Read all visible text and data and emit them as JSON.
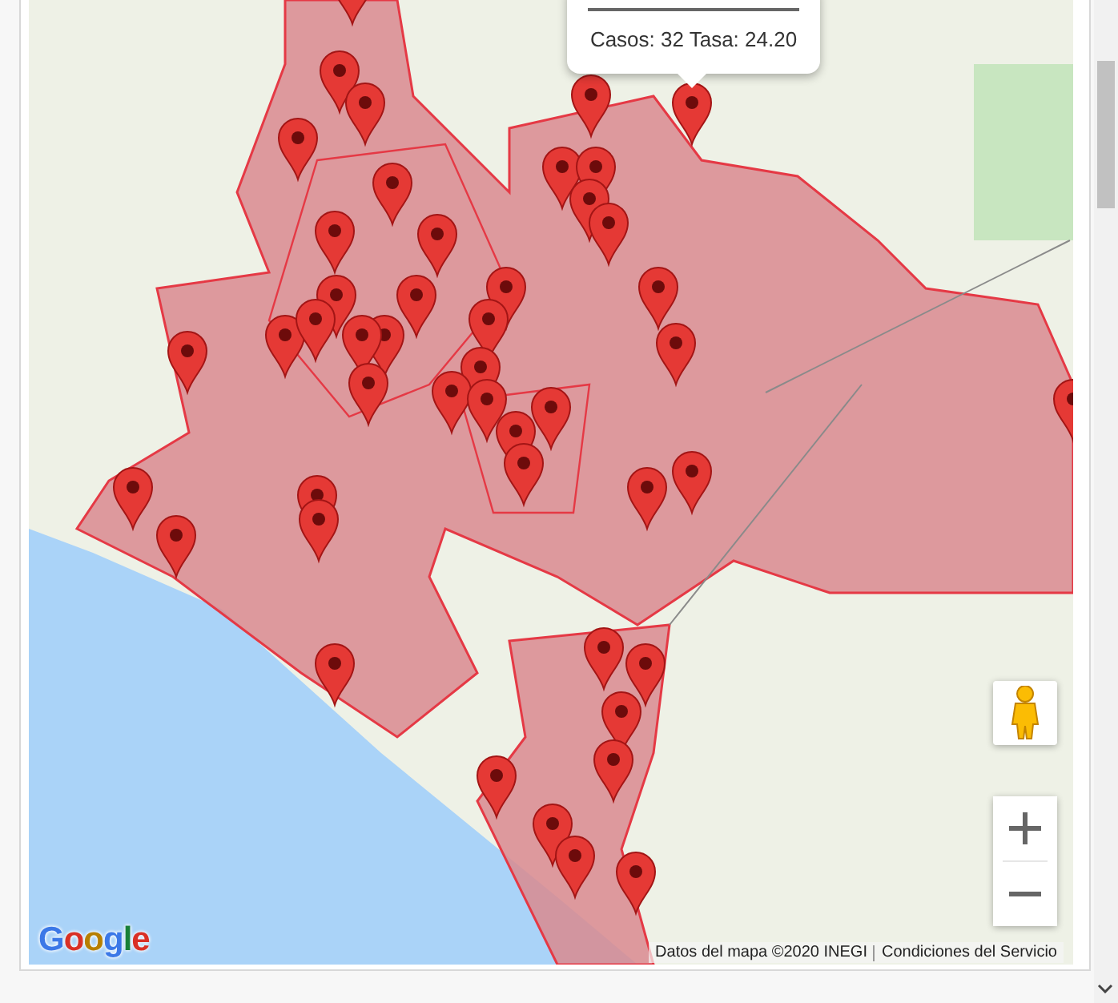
{
  "map": {
    "info_window": {
      "text": "Casos: 32 Tasa: 24.20"
    },
    "logo": "Google",
    "attribution": "Datos del mapa ©2020 INEGI",
    "terms_link": "Condiciones del Servicio"
  }
}
